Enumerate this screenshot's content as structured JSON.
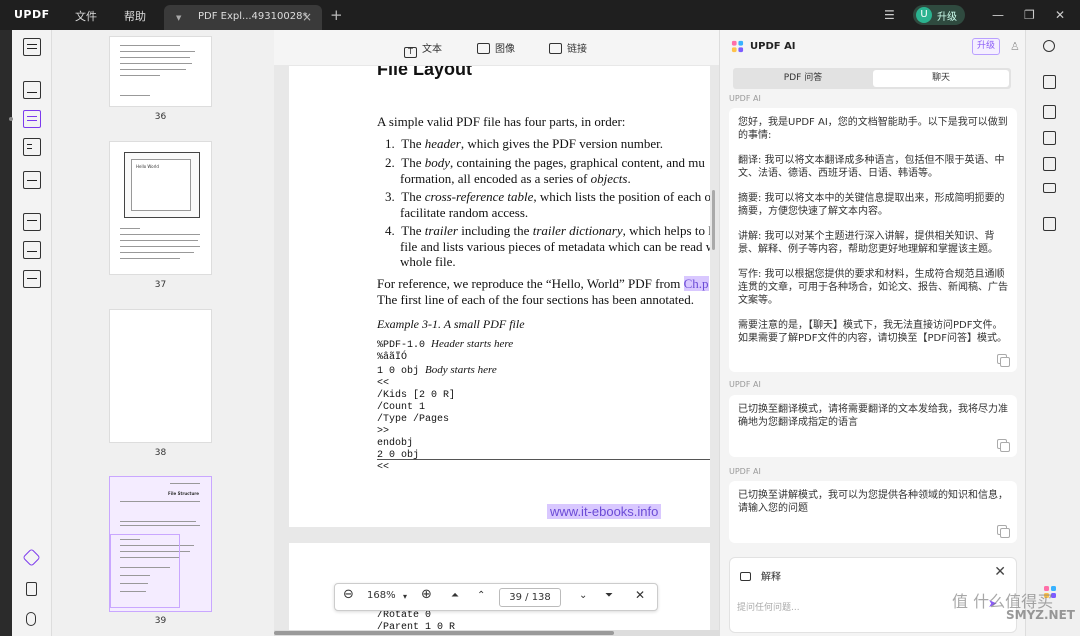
{
  "app": {
    "logo": "UPDF",
    "menu": [
      "文件",
      "帮助"
    ],
    "tab_title": "PDF Expl...49310028*",
    "upgrade_avatar": "U",
    "upgrade_label": "升级"
  },
  "thumbnails": [
    {
      "page": "36"
    },
    {
      "page": "37"
    },
    {
      "page": "38"
    },
    {
      "page": "39"
    }
  ],
  "thumb37_text": "Hello World",
  "thumb39_heading": "File Structure",
  "toolbar": {
    "text_label": "文本",
    "image_label": "图像",
    "link_label": "链接"
  },
  "doc": {
    "heading": "File Layout",
    "intro": "A simple valid PDF file has four parts, in order:",
    "items": [
      {
        "num": "1.",
        "pre": "The ",
        "em": "header",
        "post": ", which gives the PDF version number."
      },
      {
        "num": "2.",
        "pre": "The ",
        "em": "body",
        "post": ", containing the pages, graphical content, and mu",
        "cont_pre": "formation, all encoded as a series of ",
        "cont_em": "objects",
        "cont_post": "."
      },
      {
        "num": "3.",
        "pre": "The ",
        "em": "cross-reference table",
        "post": ", which lists the position of each ob",
        "cont": "facilitate random access."
      },
      {
        "num": "4.",
        "pre": "The ",
        "em": "trailer",
        "post": " including the ",
        "em2": "trailer dictionary",
        "post2": ", which helps to lo",
        "cont": "file and lists various pieces of metadata which can be read w",
        "cont2": "whole file."
      }
    ],
    "ref_pre": "For reference, we reproduce the “Hello, World” PDF from ",
    "ref_link": "Ch.p",
    "ref_line2": "The first line of each of the four sections has been annotated.",
    "example_caption": "Example 3-1. A small PDF file",
    "code": [
      {
        "code": "%PDF-1.0",
        "note": "Header starts here"
      },
      {
        "code": "%âãÏÓ",
        "note": ""
      },
      {
        "code": "1 0 obj",
        "note": "Body starts here"
      },
      {
        "code": "<<",
        "note": ""
      },
      {
        "code": "/Kids [2 0 R]",
        "note": ""
      },
      {
        "code": "/Count 1",
        "note": ""
      },
      {
        "code": "/Type /Pages",
        "note": ""
      },
      {
        "code": ">>",
        "note": ""
      },
      {
        "code": "endobj",
        "note": ""
      },
      {
        "code": "2 0 obj",
        "note": ""
      },
      {
        "code": "<<",
        "note": ""
      }
    ],
    "footer_link": "www.it-ebooks.info",
    "next_page_lines": [
      "/Rotate 0",
      "/Parent 1 0 R"
    ]
  },
  "page_control": {
    "zoom": "168%",
    "current_page": "39",
    "total_pages": "138"
  },
  "ai": {
    "title": "UPDF AI",
    "upgrade": "升级",
    "tabs": [
      "PDF 问答",
      "聊天"
    ],
    "active_tab": "聊天",
    "sender": "UPDF AI",
    "messages": [
      {
        "paragraphs": [
          "您好，我是UPDF AI，您的文档智能助手。以下是我可以做到的事情:",
          "翻译: 我可以将文本翻译成多种语言，包括但不限于英语、中文、法语、德语、西班牙语、日语、韩语等。",
          "摘要: 我可以将文本中的关键信息提取出来，形成简明扼要的摘要，方便您快速了解文本内容。",
          "讲解: 我可以对某个主题进行深入讲解，提供相关知识、背景、解释、例子等内容，帮助您更好地理解和掌握该主题。",
          "写作: 我可以根据您提供的要求和材料，生成符合规范且通顺连贯的文章，可用于各种场合，如论文、报告、新闻稿、广告文案等。",
          "需要注意的是，【聊天】模式下，我无法直接访问PDF文件。如果需要了解PDF文件的内容，请切换至【PDF问答】模式。"
        ]
      },
      {
        "paragraphs": [
          "已切换至翻译模式，请将需要翻译的文本发给我，我将尽力准确地为您翻译成指定的语言"
        ]
      },
      {
        "paragraphs": [
          "已切换至讲解模式，我可以为您提供各种领域的知识和信息，请输入您的问题"
        ]
      }
    ],
    "mode_label": "解释",
    "input_placeholder": "提问任何问题..."
  },
  "watermark": "值 什么值得买",
  "watermark2": "SMYZ.NET"
}
